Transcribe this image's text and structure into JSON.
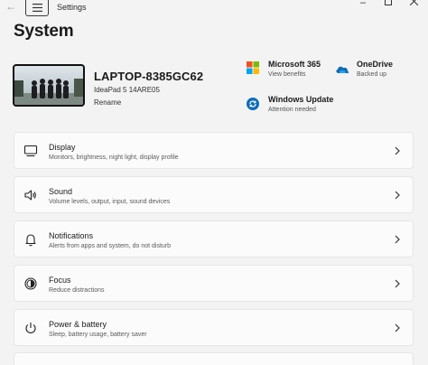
{
  "window": {
    "title": "Settings"
  },
  "page": {
    "title": "System"
  },
  "device": {
    "name": "LAPTOP-8385GC62",
    "model": "IdeaPad 5 14ARE05",
    "rename_label": "Rename"
  },
  "quick_links": [
    {
      "title": "Microsoft 365",
      "subtitle": "View benefits",
      "icon": "microsoft-365-icon"
    },
    {
      "title": "OneDrive",
      "subtitle": "Backed up",
      "icon": "onedrive-icon"
    },
    {
      "title": "Windows Update",
      "subtitle": "Attention needed",
      "icon": "windows-update-icon"
    }
  ],
  "settings": [
    {
      "title": "Display",
      "subtitle": "Monitors, brightness, night light, display profile",
      "icon": "display-icon"
    },
    {
      "title": "Sound",
      "subtitle": "Volume levels, output, input, sound devices",
      "icon": "speaker-icon"
    },
    {
      "title": "Notifications",
      "subtitle": "Alerts from apps and system, do not disturb",
      "icon": "bell-icon"
    },
    {
      "title": "Focus",
      "subtitle": "Reduce distractions",
      "icon": "focus-icon"
    },
    {
      "title": "Power & battery",
      "subtitle": "Sleep, battery usage, battery saver",
      "icon": "power-icon"
    }
  ],
  "colors": {
    "accent": "#0067c0",
    "background": "#f3f3f3",
    "card": "#fbfbfb"
  }
}
